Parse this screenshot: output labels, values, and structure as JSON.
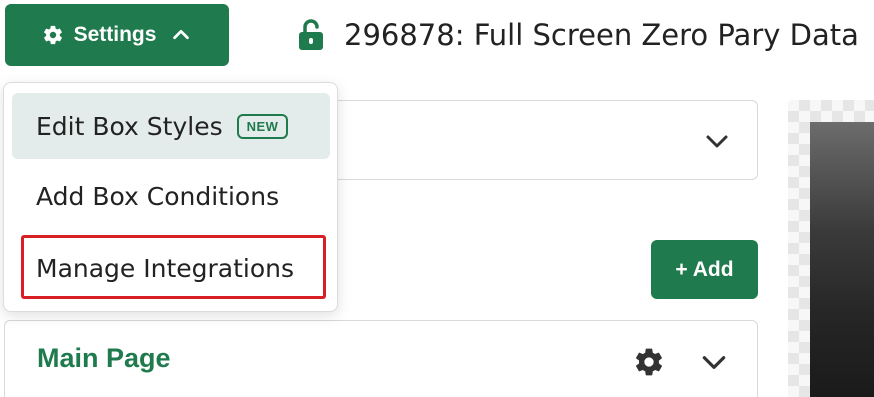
{
  "header": {
    "settings_label": "Settings",
    "title": "296878: Full Screen Zero Pary Data"
  },
  "menu": {
    "items": [
      {
        "label": "Edit Box Styles",
        "badge": "NEW",
        "active": true
      },
      {
        "label": "Add Box Conditions"
      },
      {
        "label": "Manage Integrations",
        "highlighted": true
      }
    ]
  },
  "toolbar": {
    "add_label": "+ Add"
  },
  "page_list": {
    "main_page_label": "Main Page"
  },
  "colors": {
    "brand_green": "#1f7a4d",
    "highlight_red": "#d81f26",
    "active_item_bg": "#e3ecea"
  },
  "icons": {
    "settings": "gear-icon",
    "settings_toggle": "chevron-up-icon",
    "title_status": "unlocked-padlock-icon",
    "select_toggle": "chevron-down-icon",
    "page_settings": "gear-icon",
    "page_toggle": "chevron-down-icon"
  }
}
